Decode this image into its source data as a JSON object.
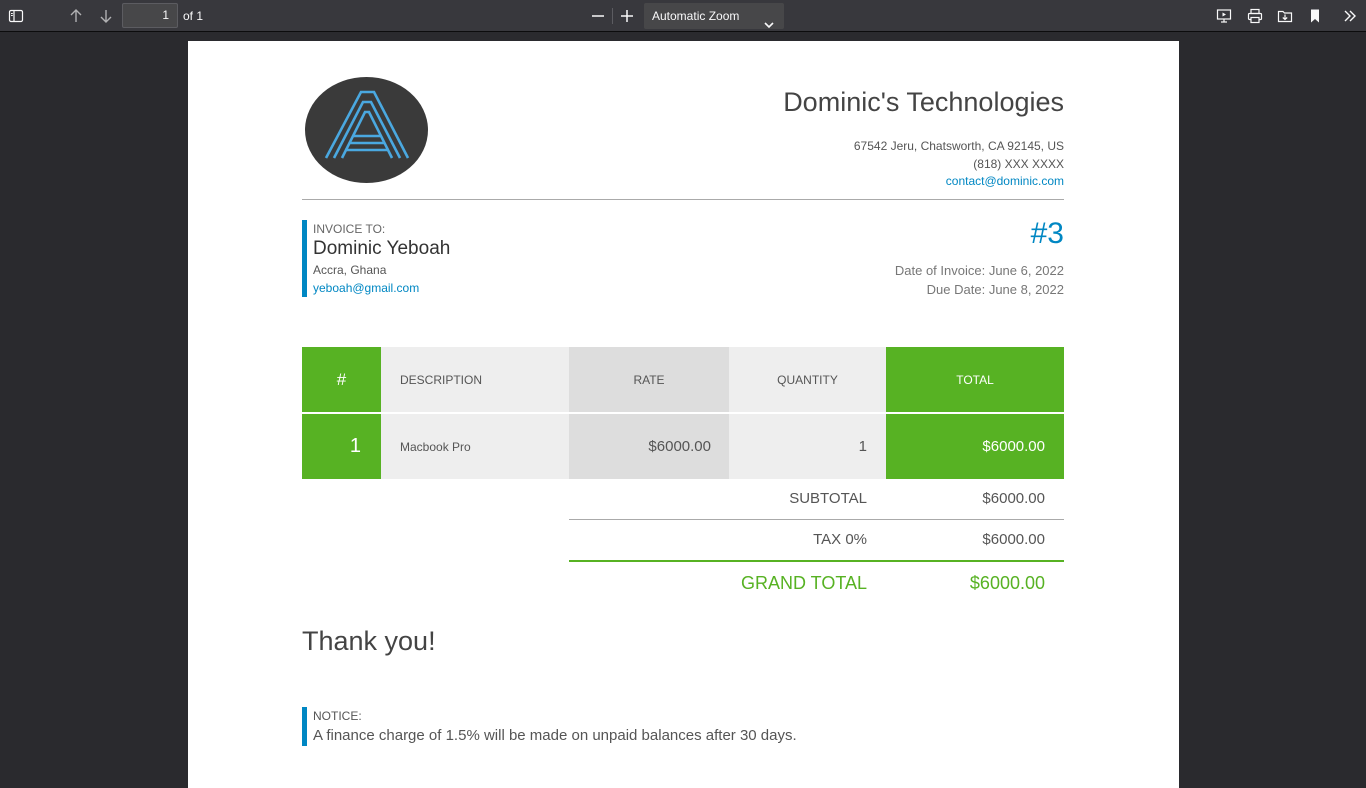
{
  "toolbar": {
    "page_number": "1",
    "page_of": "of 1",
    "zoom": "Automatic Zoom"
  },
  "company": {
    "name": "Dominic's Technologies",
    "address": "67542 Jeru, Chatsworth, CA 92145, US",
    "phone": "(818) XXX XXXX",
    "email": "contact@dominic.com"
  },
  "client": {
    "label": "INVOICE TO:",
    "name": "Dominic Yeboah",
    "location": "Accra, Ghana",
    "email": "yeboah@gmail.com"
  },
  "invoice": {
    "number": "#3",
    "date": "Date of Invoice: June 6, 2022",
    "due_date": "Due Date: June 8, 2022"
  },
  "table": {
    "headers": [
      "#",
      "DESCRIPTION",
      "RATE",
      "QUANTITY",
      "TOTAL"
    ],
    "rows": [
      [
        "1",
        "Macbook Pro",
        "$6000.00",
        "1",
        "$6000.00"
      ]
    ]
  },
  "summary": {
    "subtotal_label": "SUBTOTAL",
    "subtotal_value": "$6000.00",
    "tax_label": "TAX 0%",
    "tax_value": "$6000.00",
    "grand_total_label": "GRAND TOTAL",
    "grand_total_value": "$6000.00"
  },
  "thanks": "Thank you!",
  "notice": {
    "label": "NOTICE:",
    "text": "A finance charge of 1.5% will be made on unpaid balances after 30 days."
  },
  "colors": {
    "accent_blue": "#0087c3",
    "accent_green": "#57b223",
    "toolbar_bg": "#38383d",
    "viewer_bg": "#2a2a2e"
  },
  "icons": {
    "sidebar_toggle": "sidebar-toggle-icon",
    "previous_page": "arrow-up-icon",
    "next_page": "arrow-down-icon",
    "zoom_out": "minus-icon",
    "zoom_in": "plus-icon",
    "presentation": "presentation-icon",
    "print": "print-icon",
    "save": "save-icon",
    "bookmark": "bookmark-icon",
    "tools": "double-chevron-icon"
  }
}
